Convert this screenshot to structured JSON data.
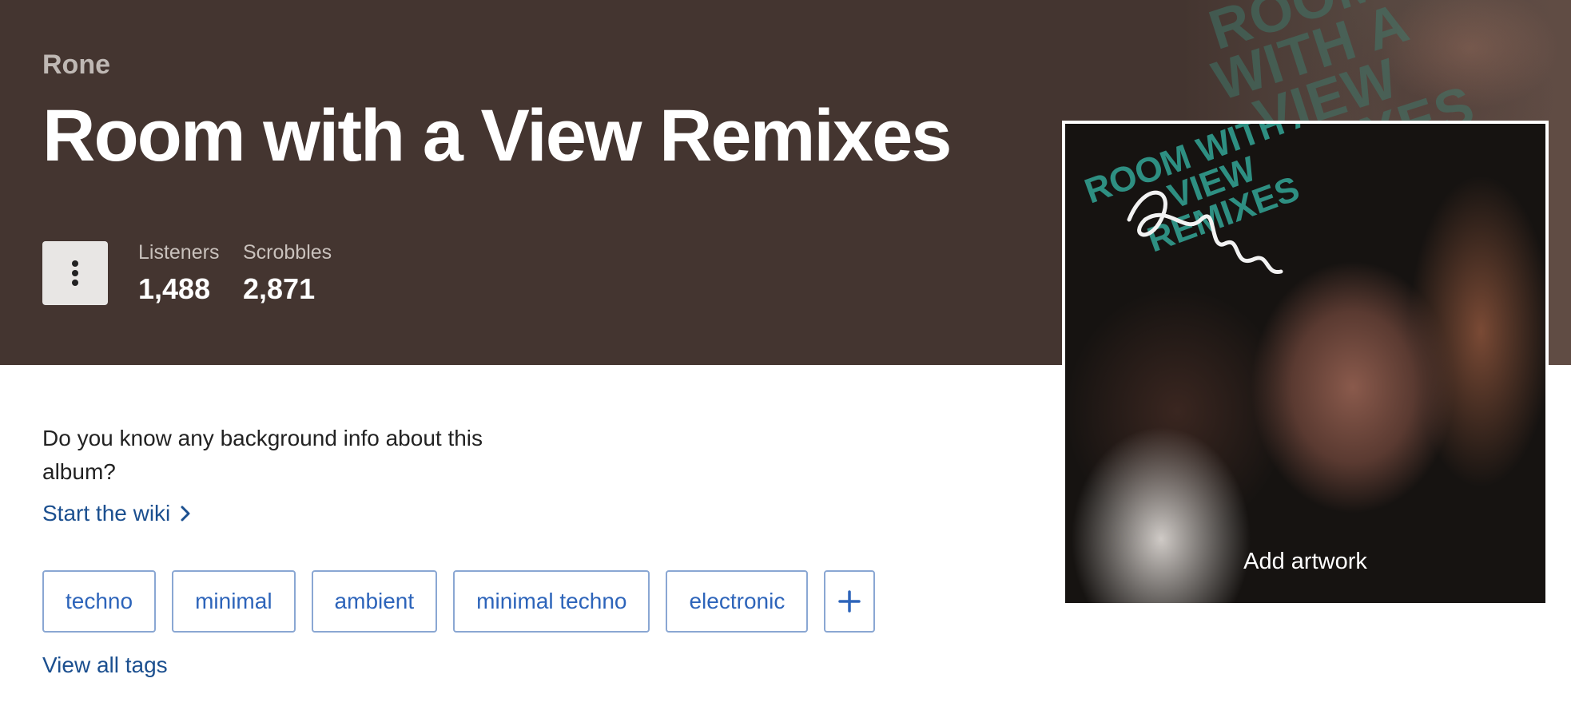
{
  "header": {
    "artist": "Rone",
    "album_title": "Room with a View Remixes",
    "background_color": "#443530",
    "menu_icon": "more-vertical-icon",
    "stats": {
      "listeners_label": "Listeners",
      "listeners_value": "1,488",
      "scrobbles_label": "Scrobbles",
      "scrobbles_value": "2,871"
    }
  },
  "artwork": {
    "cover_text": "ROOM WITH A VIEW REMIXES",
    "add_artwork_label": "Add artwork"
  },
  "wiki": {
    "question": "Do you know any background info about this album?",
    "start_link": "Start the wiki",
    "link_icon": "chevron-right-icon"
  },
  "tags": {
    "items": [
      "techno",
      "minimal",
      "ambient",
      "minimal techno",
      "electronic"
    ],
    "add_icon": "plus-icon",
    "view_all_label": "View all tags"
  },
  "colors": {
    "link": "#1b4f8f",
    "tag_text": "#2d64ba",
    "tag_border": "#8aa7d3"
  }
}
